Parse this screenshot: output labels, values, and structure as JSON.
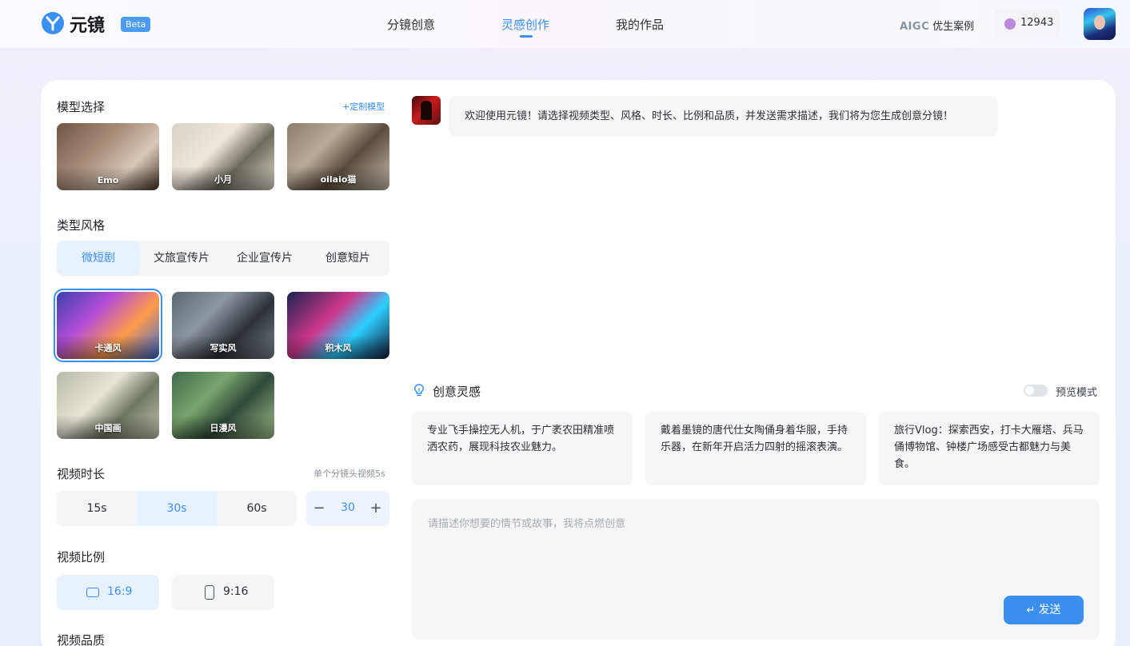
{
  "header": {
    "brand": "元镜",
    "beta": "Beta",
    "nav": [
      {
        "label": "分镜创意",
        "active": false
      },
      {
        "label": "灵感创作",
        "active": true
      },
      {
        "label": "我的作品",
        "active": false
      }
    ],
    "aigc_mark": "AIGC",
    "aigc_label": "优生案例",
    "coins": "12943",
    "accent_color": "#3a8ff0"
  },
  "left": {
    "model": {
      "title": "模型选择",
      "custom_link": "+定制模型",
      "items": [
        {
          "label": "Emo"
        },
        {
          "label": "小月"
        },
        {
          "label": "oilaio猫"
        }
      ]
    },
    "style": {
      "title": "类型风格",
      "tabs": [
        {
          "label": "微短剧",
          "active": true
        },
        {
          "label": "文旅宣传片",
          "active": false
        },
        {
          "label": "企业宣传片",
          "active": false
        },
        {
          "label": "创意短片",
          "active": false
        }
      ],
      "items": [
        {
          "label": "卡通风",
          "selected": true
        },
        {
          "label": "写实风",
          "selected": false
        },
        {
          "label": "积木风",
          "selected": false
        },
        {
          "label": "中国画",
          "selected": false
        },
        {
          "label": "日漫风",
          "selected": false
        }
      ]
    },
    "duration": {
      "title": "视频时长",
      "hint": "单个分镜头视频5s",
      "options": [
        {
          "label": "15s",
          "active": false
        },
        {
          "label": "30s",
          "active": true
        },
        {
          "label": "60s",
          "active": false
        }
      ],
      "stepper_minus": "−",
      "stepper_value": "30",
      "stepper_plus": "+"
    },
    "ratio": {
      "title": "视频比例",
      "options": [
        {
          "label": "16:9",
          "active": true,
          "icon": "landscape-icon"
        },
        {
          "label": "9:16",
          "active": false,
          "icon": "portrait-icon"
        }
      ]
    },
    "quality_title": "视频品质"
  },
  "chat": {
    "welcome": "欢迎使用元镜！请选择视频类型、风格、时长、比例和品质，并发送需求描述，我们将为您生成创意分镜！"
  },
  "inspiration": {
    "title": "创意灵感",
    "preview_label": "预览模式",
    "preview_on": false,
    "cards": [
      {
        "text": "专业飞手操控无人机，于广袤农田精准喷洒农药，展现科技农业魅力。"
      },
      {
        "text": "戴着墨镜的唐代仕女陶俑身着华服，手持乐器，在新年开启活力四射的摇滚表演。"
      },
      {
        "text": "旅行Vlog：探索西安，打卡大雁塔、兵马俑博物馆、钟楼广场感受古都魅力与美食。"
      }
    ]
  },
  "composer": {
    "placeholder": "请描述你想要的情节或故事，我将点燃创意",
    "send_label": "发送"
  }
}
